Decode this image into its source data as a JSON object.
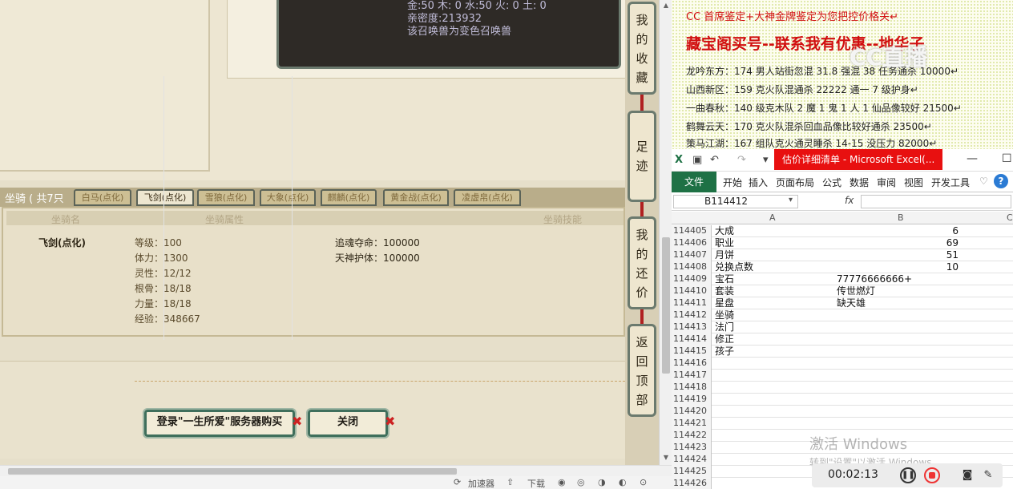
{
  "pet_tip": {
    "line1": "金:50 木: 0 水:50 火: 0 土: 0",
    "line2": "亲密度:213932",
    "line3": "该召唤兽为变色召唤兽"
  },
  "mount": {
    "title": "坐骑 ( 共7只",
    "tabs": [
      "白马(点化)",
      "飞剑(点化)",
      "雪狼(点化)",
      "大象(点化)",
      "麒麟(点化)",
      "黄金战(点化)",
      "凌虚帛(点化)"
    ],
    "headers": {
      "name": "坐骑名",
      "attrs": "坐骑属性",
      "skills": "坐骑技能"
    },
    "name": "飞剑(点化)",
    "attrs": [
      "等级：100",
      "体力：1300",
      "灵性：12/12",
      "根骨：18/18",
      "力量：18/18",
      "经验：348667"
    ],
    "skills": [
      "追魂夺命：100000",
      "天神护体：100000"
    ]
  },
  "buttons": {
    "login": "登录\"一生所爱\"服务器购买",
    "close": "关闭",
    "x": "✖"
  },
  "side": {
    "fav": [
      "我",
      "的",
      "收",
      "藏"
    ],
    "footprint": [
      "足",
      "迹"
    ],
    "bargain": [
      "我",
      "的",
      "还",
      "价"
    ],
    "top": [
      "返",
      "回",
      "顶",
      "部"
    ]
  },
  "statusbar": {
    "speed": "加速器",
    "download": "下载"
  },
  "notice": {
    "line1": "CC 首席鉴定+大神金牌鉴定为您把控价格关↵",
    "line2": "藏宝阁买号--联系我有优惠--地华子",
    "rows": [
      "龙吟东方：174 男人站街忽混 31.8 强混 38 任务通杀 10000↵",
      "山西新区：159 克火队混通杀 22222 通一 7 级护身↵",
      "一曲春秋：140 级克木队 2 魔 1 鬼 1 人 1 仙品像较好 21500↵",
      "鹤舞云天：170 克火队混杀回血品像比较好通杀 23500↵",
      "策马江湖：167 组队克火通灵睡杀 14-15 没压力 82000↵"
    ],
    "logo": "CC直播"
  },
  "excel": {
    "title": "估价详细清单 - Microsoft Excel(...",
    "file_tab": "文件",
    "ribbon": [
      "开始",
      "插入",
      "页面布局",
      "公式",
      "数据",
      "审阅",
      "视图",
      "开发工具"
    ],
    "namebox": "B114412",
    "fx": "fx",
    "columns": [
      "A",
      "B",
      "C"
    ],
    "rows": [
      {
        "n": "114405",
        "a": "大成",
        "b": "6",
        "num": true
      },
      {
        "n": "114406",
        "a": "职业",
        "b": "69",
        "num": true
      },
      {
        "n": "114407",
        "a": "月饼",
        "b": "51",
        "num": true
      },
      {
        "n": "114408",
        "a": "兑换点数",
        "b": "10",
        "num": true
      },
      {
        "n": "114409",
        "a": "宝石",
        "b": "77776666666+",
        "num": false
      },
      {
        "n": "114410",
        "a": "套装",
        "b": "传世燃灯",
        "num": false
      },
      {
        "n": "114411",
        "a": "星盘",
        "b": "缺天雄",
        "num": false
      },
      {
        "n": "114412",
        "a": "坐骑",
        "b": "",
        "num": false
      },
      {
        "n": "114413",
        "a": "法门",
        "b": "",
        "num": false
      },
      {
        "n": "114414",
        "a": "修正",
        "b": "",
        "num": false
      },
      {
        "n": "114415",
        "a": "孩子",
        "b": "",
        "num": false
      },
      {
        "n": "114416",
        "a": "",
        "b": "",
        "num": false
      },
      {
        "n": "114417",
        "a": "",
        "b": "",
        "num": false
      },
      {
        "n": "114418",
        "a": "",
        "b": "",
        "num": false
      },
      {
        "n": "114419",
        "a": "",
        "b": "",
        "num": false
      },
      {
        "n": "114420",
        "a": "",
        "b": "",
        "num": false
      },
      {
        "n": "114421",
        "a": "",
        "b": "",
        "num": false
      },
      {
        "n": "114422",
        "a": "",
        "b": "",
        "num": false
      },
      {
        "n": "114423",
        "a": "",
        "b": "",
        "num": false
      },
      {
        "n": "114424",
        "a": "",
        "b": "",
        "num": false
      },
      {
        "n": "114425",
        "a": "",
        "b": "",
        "num": false
      },
      {
        "n": "114426",
        "a": "",
        "b": "",
        "num": false
      }
    ]
  },
  "watermark": {
    "line1": "激活 Windows",
    "line2": "转到\"设置\"以激活 Windows。"
  },
  "recorder": {
    "time": "00:02:13"
  }
}
